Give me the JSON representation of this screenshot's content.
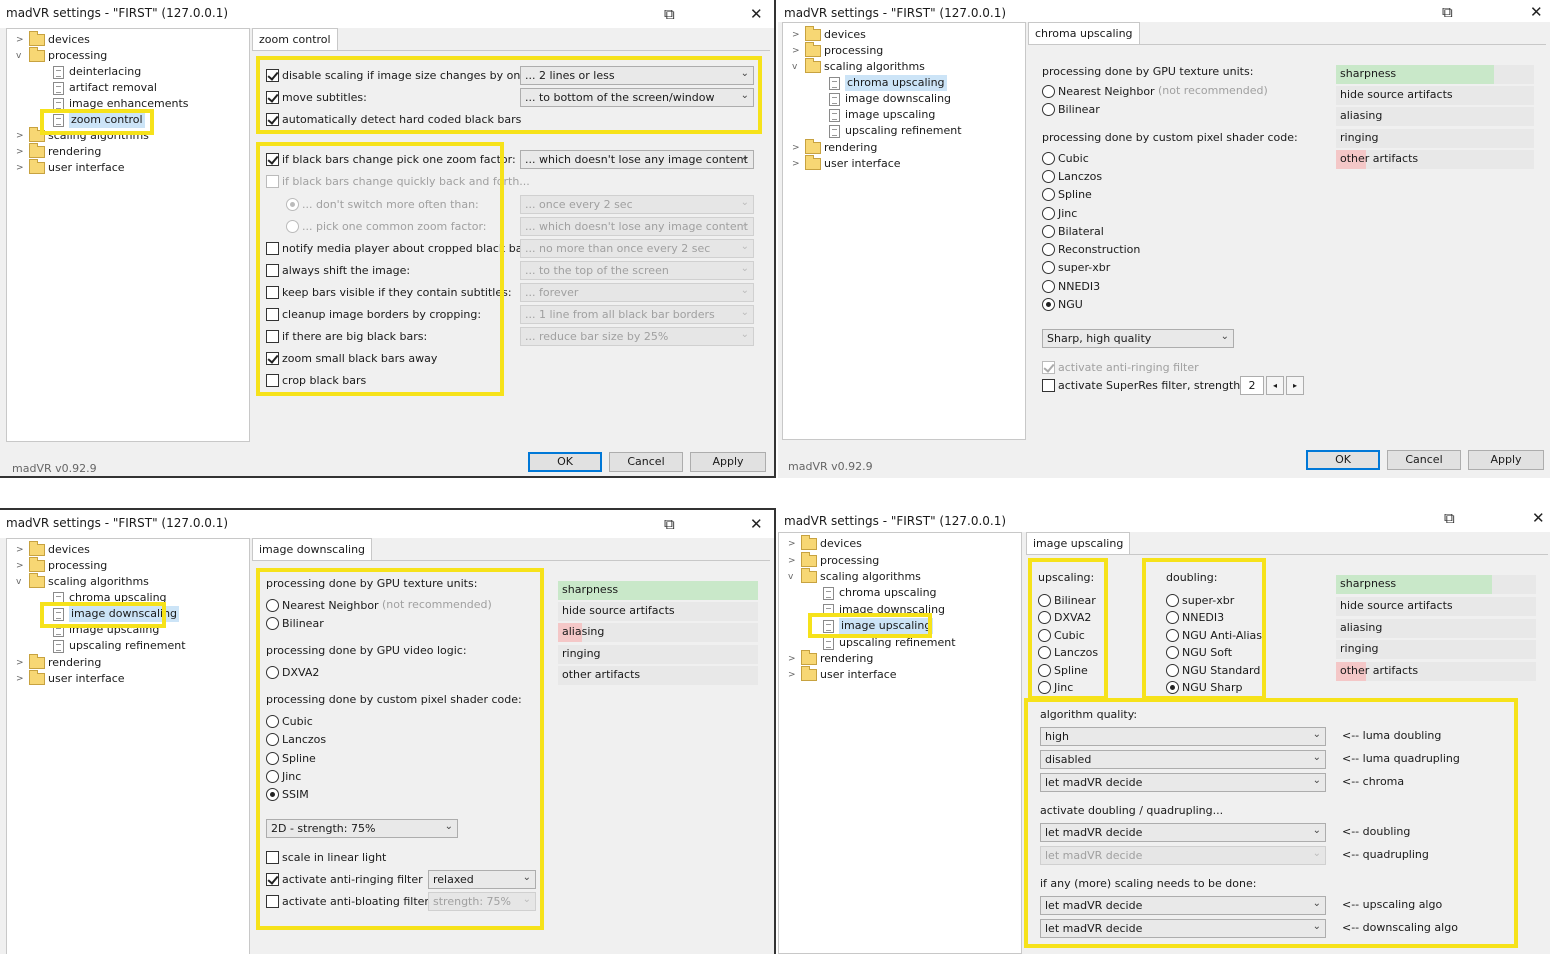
{
  "common": {
    "window_title": "madVR settings - \"FIRST\" (127.0.0.1)",
    "version": "madVR v0.92.9",
    "ok": "OK",
    "cancel": "Cancel",
    "apply": "Apply",
    "close_glyph": "✕",
    "pin_glyph": "⧉",
    "ddarrow": "⌄",
    "caret_closed": ">",
    "caret_open": "v"
  },
  "tree": {
    "devices": "devices",
    "processing": "processing",
    "deinterlacing": "deinterlacing",
    "artifact_removal": "artifact removal",
    "image_enhancements": "image enhancements",
    "zoom_control": "zoom control",
    "scaling_algorithms": "scaling algorithms",
    "chroma_upscaling": "chroma upscaling",
    "image_downscaling": "image downscaling",
    "image_upscaling": "image upscaling",
    "upscaling_refinement": "upscaling refinement",
    "rendering": "rendering",
    "user_interface": "user interface"
  },
  "zoom": {
    "tab": "zoom control",
    "disable_scaling": "disable scaling if image size changes by only:",
    "disable_scaling_value": "... 2 lines or less",
    "move_subtitles": "move subtitles:",
    "move_subtitles_value": "... to bottom of the screen/window",
    "auto_detect": "automatically detect hard coded black bars",
    "pick_zoom": "if black bars change pick one zoom factor:",
    "pick_zoom_value": "... which doesn't lose any image content",
    "change_quickly": "if black bars change quickly back and forth...",
    "dont_switch": "... don't switch more often than:",
    "dont_switch_value": "... once every 2 sec",
    "pick_common": "... pick one common zoom factor:",
    "pick_common_value": "... which doesn't lose any image content",
    "notify": "notify media player about cropped black bars",
    "notify_value": "... no more than once every 2 sec",
    "always_shift": "always shift the image:",
    "always_shift_value": "... to the top of the screen",
    "keep_bars": "keep bars visible if they contain subtitles:",
    "keep_bars_value": "... forever",
    "cleanup": "cleanup image borders by cropping:",
    "cleanup_value": "... 1 line from all black bar borders",
    "big_bars": "if there are big black bars:",
    "big_bars_value": "... reduce bar size by 25%",
    "zoom_small": "zoom small black bars away",
    "crop": "crop black bars"
  },
  "quality_labels": {
    "sharpness": "sharpness",
    "hide": "hide source artifacts",
    "aliasing": "aliasing",
    "ringing": "ringing",
    "other": "other artifacts"
  },
  "chroma": {
    "tab": "chroma upscaling",
    "gpu_header": "processing done by GPU texture units:",
    "nearest": "Nearest Neighbor",
    "not_recommended": "(not recommended)",
    "bilinear": "Bilinear",
    "shader_header": "processing done by custom pixel shader code:",
    "cubic": "Cubic",
    "lanczos": "Lanczos",
    "spline": "Spline",
    "jinc": "Jinc",
    "bilateral": "Bilateral",
    "reconstruction": "Reconstruction",
    "superxbr": "super-xbr",
    "nnedi3": "NNEDI3",
    "ngu": "NGU",
    "quality_value": "Sharp, high quality",
    "anti_ringing": "activate anti-ringing filter",
    "superres": "activate SuperRes filter, strength:",
    "superres_strength": "2",
    "spin_left": "◂",
    "spin_right": "▸"
  },
  "downscaling": {
    "tab": "image downscaling",
    "gpu_header": "processing done by GPU texture units:",
    "nearest": "Nearest Neighbor",
    "not_recommended": "(not recommended)",
    "bilinear": "Bilinear",
    "video_header": "processing done by GPU video logic:",
    "dxva2": "DXVA2",
    "shader_header": "processing done by custom pixel shader code:",
    "cubic": "Cubic",
    "lanczos": "Lanczos",
    "spline": "Spline",
    "jinc": "Jinc",
    "ssim": "SSIM",
    "ssim_value": "2D - strength: 75%",
    "linear_light": "scale in linear light",
    "anti_ringing": "activate anti-ringing filter",
    "anti_ringing_value": "relaxed",
    "anti_bloating": "activate anti-bloating filter",
    "anti_bloating_value": "strength: 75%"
  },
  "upscaling": {
    "tab": "image upscaling",
    "upscaling_header": "upscaling:",
    "bilinear": "Bilinear",
    "dxva2": "DXVA2",
    "cubic": "Cubic",
    "lanczos": "Lanczos",
    "spline": "Spline",
    "jinc": "Jinc",
    "doubling_header": "doubling:",
    "superxbr": "super-xbr",
    "nnedi3": "NNEDI3",
    "ngu_aa": "NGU Anti-Alias",
    "ngu_soft": "NGU Soft",
    "ngu_standard": "NGU Standard",
    "ngu_sharp": "NGU Sharp",
    "algo_quality": "algorithm quality:",
    "q_luma_doubling": "high",
    "q_luma_doubling_note": "<-- luma doubling",
    "q_luma_quad": "disabled",
    "q_luma_quad_note": "<-- luma quadrupling",
    "q_chroma": "let madVR decide",
    "q_chroma_note": "<-- chroma",
    "activate_header": "activate doubling / quadrupling...",
    "a_doubling": "let madVR decide",
    "a_doubling_note": "<-- doubling",
    "a_quad": "let madVR decide",
    "a_quad_note": "<-- quadrupling",
    "more_header": "if any (more) scaling needs to be done:",
    "m_up": "let madVR decide",
    "m_up_note": "<-- upscaling algo",
    "m_down": "let madVR decide",
    "m_down_note": "<-- downscaling algo"
  },
  "colors": {
    "highlight": "#f6e21a",
    "good": "#c9e8c9",
    "bad": "#f4c7c7",
    "selection": "#cce4f7"
  },
  "quality_bars": {
    "chroma": {
      "sharpness": 0.8,
      "hide": 0,
      "aliasing": 0,
      "ringing": 0,
      "other": 0.15
    },
    "downscaling": {
      "sharpness": 1.0,
      "hide": 0,
      "aliasing": 0.12,
      "ringing": 0,
      "other": 0
    },
    "upscaling": {
      "sharpness": 0.78,
      "hide": 0,
      "aliasing": 0,
      "ringing": 0,
      "other": 0.15
    }
  }
}
